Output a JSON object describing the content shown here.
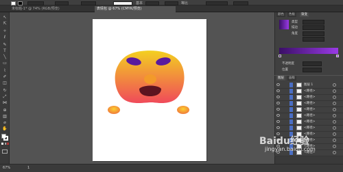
{
  "control_bar": {
    "uniform_label": "等比",
    "style_label": "基本"
  },
  "tabs": [
    {
      "label": "未标题-1* @ 74% (RGB/预览)",
      "active": false
    },
    {
      "label": "表情包 @ 67% (CMYK/预览)",
      "active": true
    }
  ],
  "colors": {
    "face_top": "#f3d020",
    "face_bottom": "#f04a5a",
    "eyes": "#5a1a9e",
    "mouth": "#5c1420",
    "panel_gradient_start": "#3a0f66",
    "panel_gradient_end": "#9a3ae6"
  },
  "panels": {
    "color_tabs": [
      "颜色",
      "色板",
      "渐变"
    ],
    "gradient": {
      "type_label": "类型",
      "stroke_label": "描边",
      "angle_label": "角度",
      "opacity_label": "不透明度",
      "position_label": "位置"
    },
    "layers": {
      "tabs": [
        "图层",
        "画板"
      ],
      "rows": [
        "图层 1",
        "<路径>",
        "<路径>",
        "<路径>",
        "<路径>",
        "<路径>",
        "<路径>",
        "<路径>",
        "<路径>",
        "<路径>",
        "<路径>",
        "<路径>"
      ]
    }
  },
  "status_bar": {
    "zoom": "67%",
    "page": "1"
  },
  "watermark": {
    "site": "Baidu经验",
    "url": "jingyan.baidu.com"
  }
}
